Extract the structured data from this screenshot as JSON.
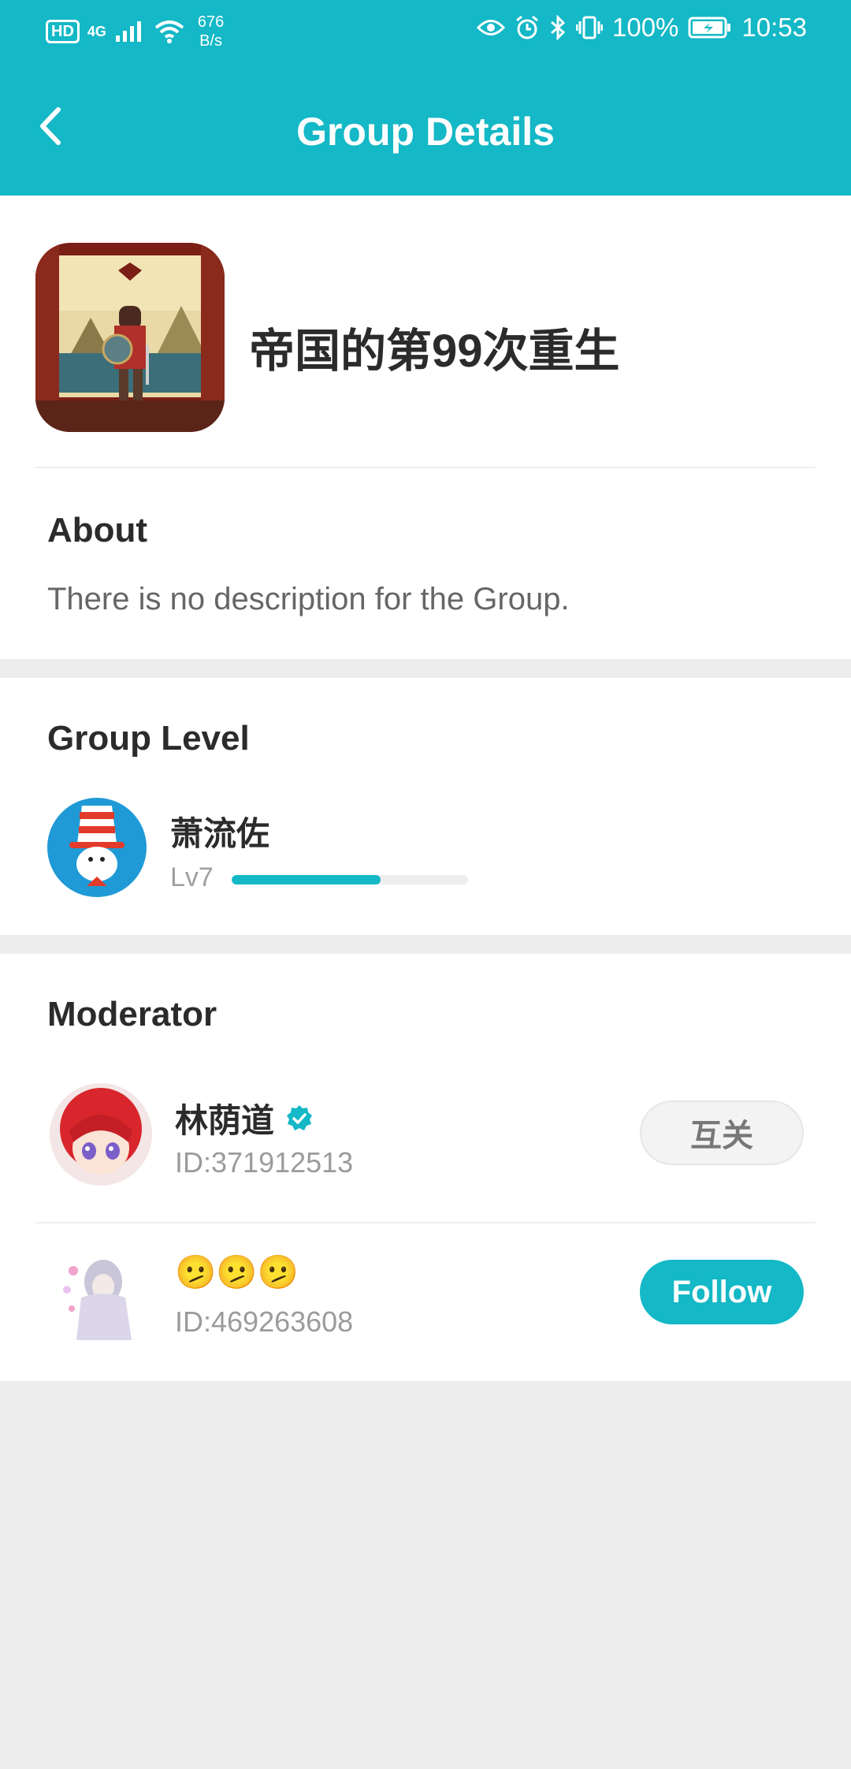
{
  "colors": {
    "accent": "#14b8c6"
  },
  "status_bar": {
    "hd": "HD",
    "network": "4G",
    "net_speed_value": "676",
    "net_speed_unit": "B/s",
    "battery": "100%",
    "time": "10:53",
    "icons": [
      "eye-icon",
      "alarm-icon",
      "bluetooth-icon",
      "vibrate-icon",
      "battery-icon"
    ]
  },
  "header": {
    "title": "Group Details",
    "back_icon": "chevron-left-icon"
  },
  "group": {
    "name": "帝国的第99次重生"
  },
  "about": {
    "title": "About",
    "description": "There is no description for the Group."
  },
  "group_level": {
    "title": "Group Level",
    "user_name": "萧流佐",
    "level": "Lv7",
    "progress": 0.63
  },
  "moderator": {
    "title": "Moderator",
    "members": [
      {
        "name": "林荫道",
        "verified": true,
        "id": "ID:371912513",
        "button": "互关"
      },
      {
        "name": "🫤🫤🫤",
        "verified": false,
        "id": "ID:469263608",
        "button": "Follow"
      }
    ]
  }
}
